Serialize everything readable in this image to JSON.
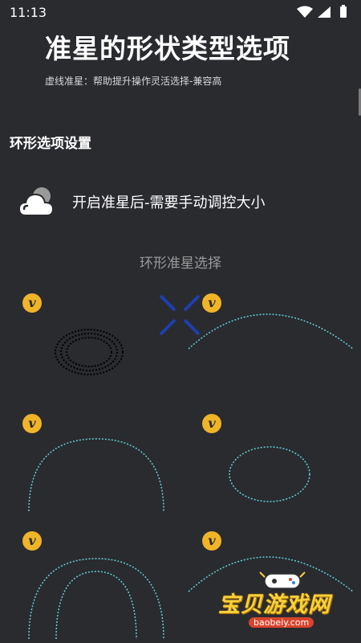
{
  "status": {
    "time": "11:13"
  },
  "header": {
    "title": "准星的形状类型选项",
    "subtitle": "虚线准星：帮助提升操作灵活选择-兼容高"
  },
  "section": {
    "title": "环形选项设置"
  },
  "switch_row": {
    "label": "开启准星后-需要手动调控大小"
  },
  "picker": {
    "title": "环形准星选择",
    "check_glyph": "v"
  },
  "watermark": {
    "text": "宝贝游戏网",
    "url": "baobeiy.com"
  },
  "colors": {
    "accent": "#f0b429",
    "dotted": "#5fd0d6",
    "cross": "#1e3fae",
    "background": "#2a2b2f"
  }
}
